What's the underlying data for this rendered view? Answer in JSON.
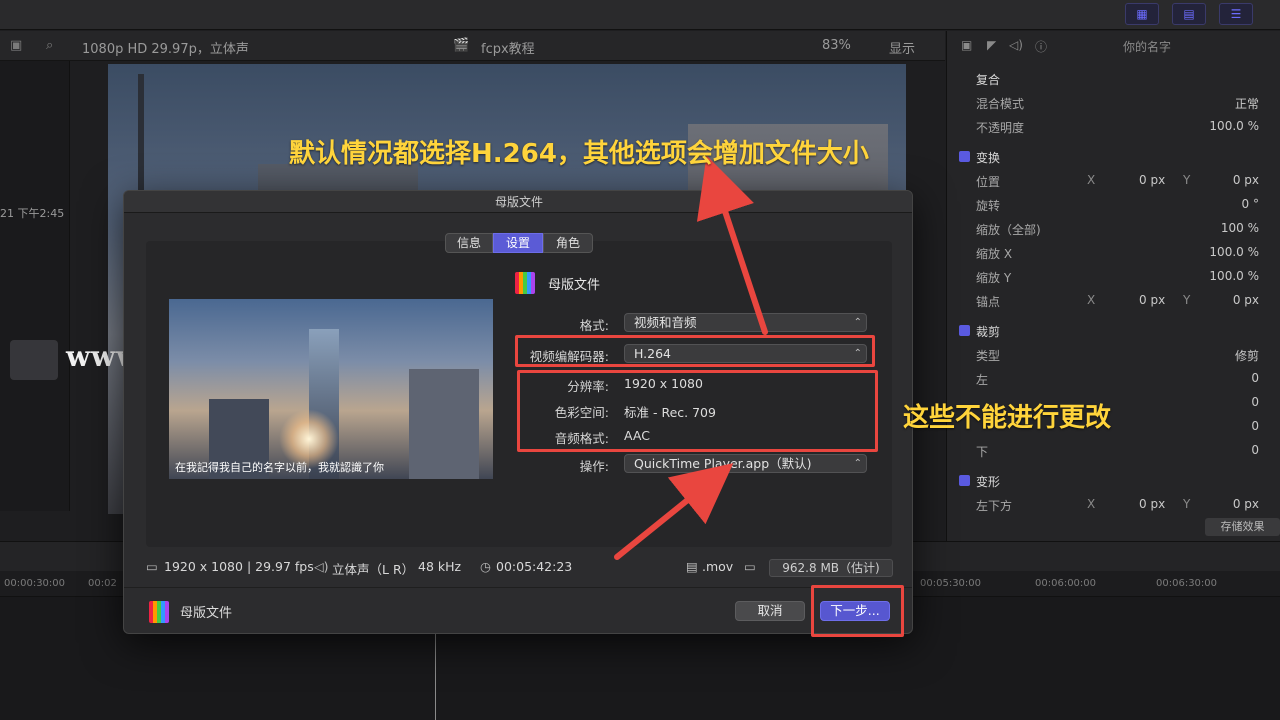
{
  "viewer_header": {
    "format": "1080p HD 29.97p，立体声",
    "project": "fcpx教程",
    "zoom": "83%",
    "display": "显示"
  },
  "browser": {
    "timestamp": "21 下午2:45"
  },
  "inspector": {
    "clip_name": "你的名字",
    "sections": [
      {
        "title": "复合"
      },
      {
        "label": "混合模式",
        "value": "正常"
      },
      {
        "label": "不透明度",
        "value": "100.0 %"
      },
      {
        "title": "变换"
      },
      {
        "label": "位置",
        "x_label": "X",
        "x": "0 px",
        "y_label": "Y",
        "y": "0 px"
      },
      {
        "label": "旋转",
        "value": "0 °"
      },
      {
        "label": "缩放（全部)",
        "value": "100 %"
      },
      {
        "label": "缩放 X",
        "value": "100.0 %"
      },
      {
        "label": "缩放 Y",
        "value": "100.0 %"
      },
      {
        "label": "锚点",
        "x_label": "X",
        "x": "0 px",
        "y_label": "Y",
        "y": "0 px"
      },
      {
        "title": "裁剪"
      },
      {
        "label": "类型",
        "value": "修剪"
      },
      {
        "label": "左",
        "value": "0"
      },
      {
        "label": "",
        "value": "0"
      },
      {
        "label": "",
        "value": "0"
      },
      {
        "label": "下",
        "value": "0"
      },
      {
        "title": "变形"
      },
      {
        "label": "左下方",
        "x_label": "X",
        "x": "0 px",
        "y_label": "Y",
        "y": "0 px"
      }
    ],
    "save_effect": "存储效果"
  },
  "ruler": [
    "00:00:30:00",
    "00:02",
    "00:05:30:00",
    "00:06:00:00",
    "00:06:30:00"
  ],
  "watermark": "www.MacW.com",
  "dialog": {
    "title": "母版文件",
    "tabs": [
      "信息",
      "设置",
      "角色"
    ],
    "active_tab": "设置",
    "heading": "母版文件",
    "subtitle_preview": "在我記得我自己的名字以前，我就認識了你",
    "format_label": "格式:",
    "format_value": "视频和音频",
    "codec_label": "视频编解码器:",
    "codec_value": "H.264",
    "resolution_label": "分辨率:",
    "resolution_value": "1920 x 1080",
    "colorspace_label": "色彩空间:",
    "colorspace_value": "标准 - Rec. 709",
    "audio_label": "音频格式:",
    "audio_value": "AAC",
    "action_label": "操作:",
    "action_value": "QuickTime Player.app（默认)",
    "info": {
      "resolution_fps": "1920 x 1080 | 29.97 fps",
      "audio": "立体声（L R）",
      "sample_rate": "48 kHz",
      "duration": "00:05:42:23",
      "extension": ".mov",
      "size": "962.8 MB（估计)"
    },
    "footer_title": "母版文件",
    "cancel": "取消",
    "next": "下一步..."
  },
  "annotations": {
    "top_note": "默认情况都选择H.264，其他选项会增加文件大小",
    "right_note": "这些不能进行更改"
  },
  "colors": {
    "annotation_red": "#e9463f",
    "annotation_yellow": "#ffd43b",
    "accent": "#5757d0"
  }
}
